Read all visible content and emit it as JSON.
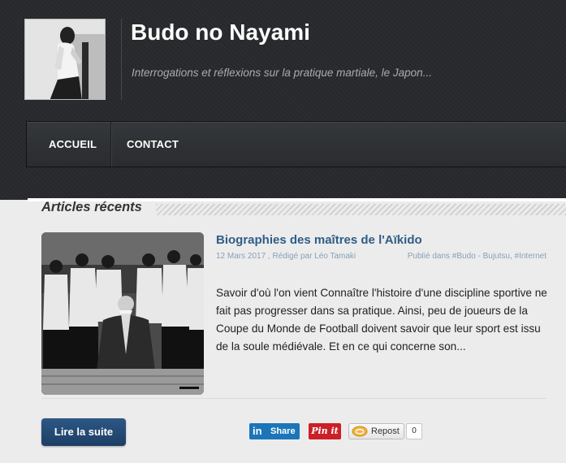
{
  "site": {
    "title": "Budo no Nayami",
    "tagline": "Interrogations et réflexions sur la pratique martiale, le Japon..."
  },
  "nav": {
    "items": [
      {
        "label": "ACCUEIL"
      },
      {
        "label": "CONTACT"
      }
    ]
  },
  "section": {
    "title": "Articles récents"
  },
  "post": {
    "title": "Biographies des maîtres de l'Aïkido",
    "meta": "12 Mars 2017 , Rédigé par Léo Tamaki",
    "tags": "Publié dans #Budo - Bujutsu, #Internet",
    "excerpt": "Savoir d'où l'on vient Connaître l'histoire d'une discipline sportive ne fait pas progresser dans sa pratique. Ainsi, peu de joueurs de la Coupe du Monde de Football doivent savoir que leur sport est issu de la soule médiévale. Et en ce qui concerne son...",
    "read_more": "Lire la suite"
  },
  "share": {
    "linkedin_icon": "in",
    "linkedin_label": "Share",
    "pinterest_label": "Pin it",
    "repost_label": "Repost",
    "repost_count": "0"
  },
  "colors": {
    "header_bg": "#2a2c2f",
    "link_blue": "#2f5d87",
    "button_blue": "#1d3f65",
    "linkedin": "#1c75b8",
    "pinterest": "#cb2027"
  }
}
